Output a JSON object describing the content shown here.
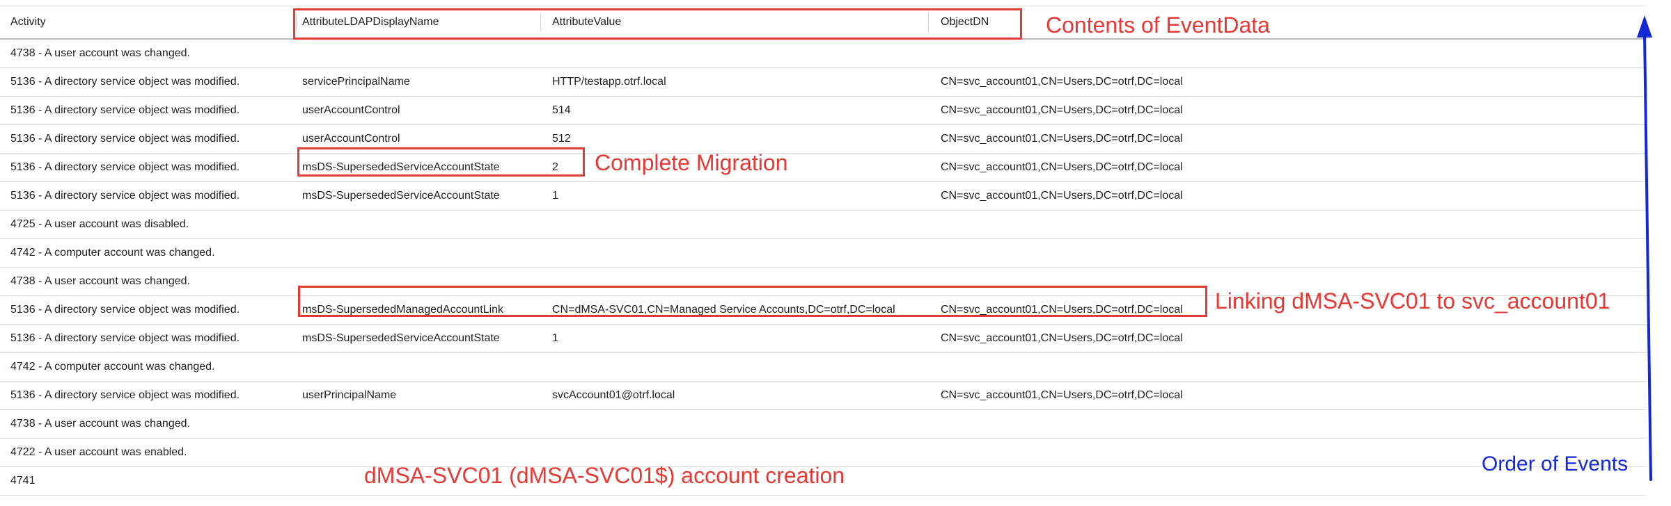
{
  "columns": {
    "activity": "Activity",
    "attr_ldap": "AttributeLDAPDisplayName",
    "attr_value": "AttributeValue",
    "object_dn": "ObjectDN"
  },
  "rows": [
    {
      "activity": "4738 - A user account was changed.",
      "attr_ldap": "",
      "attr_value": "",
      "object_dn": ""
    },
    {
      "activity": "5136 - A directory service object was modified.",
      "attr_ldap": "servicePrincipalName",
      "attr_value": "HTTP/testapp.otrf.local",
      "object_dn": "CN=svc_account01,CN=Users,DC=otrf,DC=local"
    },
    {
      "activity": "5136 - A directory service object was modified.",
      "attr_ldap": "userAccountControl",
      "attr_value": "514",
      "object_dn": "CN=svc_account01,CN=Users,DC=otrf,DC=local"
    },
    {
      "activity": "5136 - A directory service object was modified.",
      "attr_ldap": "userAccountControl",
      "attr_value": "512",
      "object_dn": "CN=svc_account01,CN=Users,DC=otrf,DC=local"
    },
    {
      "activity": "5136 - A directory service object was modified.",
      "attr_ldap": "msDS-SupersededServiceAccountState",
      "attr_value": "2",
      "object_dn": "CN=svc_account01,CN=Users,DC=otrf,DC=local"
    },
    {
      "activity": "5136 - A directory service object was modified.",
      "attr_ldap": "msDS-SupersededServiceAccountState",
      "attr_value": "1",
      "object_dn": "CN=svc_account01,CN=Users,DC=otrf,DC=local"
    },
    {
      "activity": "4725 - A user account was disabled.",
      "attr_ldap": "",
      "attr_value": "",
      "object_dn": ""
    },
    {
      "activity": "4742 - A computer account was changed.",
      "attr_ldap": "",
      "attr_value": "",
      "object_dn": ""
    },
    {
      "activity": "4738 - A user account was changed.",
      "attr_ldap": "",
      "attr_value": "",
      "object_dn": ""
    },
    {
      "activity": "5136 - A directory service object was modified.",
      "attr_ldap": "msDS-SupersededManagedAccountLink",
      "attr_value": "CN=dMSA-SVC01,CN=Managed Service Accounts,DC=otrf,DC=local",
      "object_dn": "CN=svc_account01,CN=Users,DC=otrf,DC=local"
    },
    {
      "activity": "5136 - A directory service object was modified.",
      "attr_ldap": "msDS-SupersededServiceAccountState",
      "attr_value": "1",
      "object_dn": "CN=svc_account01,CN=Users,DC=otrf,DC=local"
    },
    {
      "activity": "4742 - A computer account was changed.",
      "attr_ldap": "",
      "attr_value": "",
      "object_dn": ""
    },
    {
      "activity": "5136 - A directory service object was modified.",
      "attr_ldap": "userPrincipalName",
      "attr_value": "svcAccount01@otrf.local",
      "object_dn": "CN=svc_account01,CN=Users,DC=otrf,DC=local"
    },
    {
      "activity": "4738 - A user account was changed.",
      "attr_ldap": "",
      "attr_value": "",
      "object_dn": ""
    },
    {
      "activity": "4722 - A user account was enabled.",
      "attr_ldap": "",
      "attr_value": "",
      "object_dn": ""
    },
    {
      "activity": "4741",
      "attr_ldap": "",
      "attr_value": "",
      "object_dn": ""
    }
  ],
  "annotations": {
    "contents_of_eventdata": "Contents of EventData",
    "complete_migration": "Complete Migration",
    "linking": "Linking dMSA-SVC01 to svc_account01",
    "account_creation": "dMSA-SVC01 (dMSA-SVC01$) account creation",
    "order_of_events": "Order of Events"
  },
  "colors": {
    "annotation_red": "#e53935",
    "annotation_blue": "#1428d6",
    "row_border": "#dcdcdc"
  }
}
